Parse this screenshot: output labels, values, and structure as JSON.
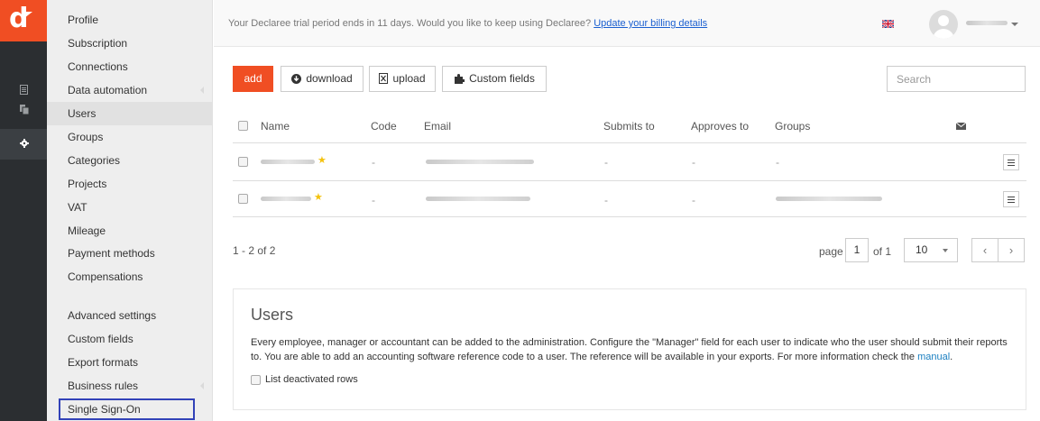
{
  "sidebar": {
    "items": [
      {
        "label": "Profile"
      },
      {
        "label": "Subscription"
      },
      {
        "label": "Connections"
      },
      {
        "label": "Data automation"
      },
      {
        "label": "Users"
      },
      {
        "label": "Groups"
      },
      {
        "label": "Categories"
      },
      {
        "label": "Projects"
      },
      {
        "label": "VAT"
      },
      {
        "label": "Mileage"
      },
      {
        "label": "Payment methods"
      },
      {
        "label": "Compensations"
      }
    ],
    "advanced": [
      {
        "label": "Advanced settings"
      },
      {
        "label": "Custom fields"
      },
      {
        "label": "Export formats"
      },
      {
        "label": "Business rules"
      },
      {
        "label": "Single Sign-On"
      }
    ]
  },
  "topbar": {
    "trial_text": "Your Declaree trial period ends in 11 days. Would you like to keep using Declaree? ",
    "billing_link": "Update your billing details"
  },
  "toolbar": {
    "add_label": "add",
    "download_label": "download",
    "upload_label": "upload",
    "custom_fields_label": "Custom fields",
    "search_placeholder": "Search"
  },
  "table": {
    "columns": {
      "name": "Name",
      "code": "Code",
      "email": "Email",
      "submits_to": "Submits to",
      "approves_to": "Approves to",
      "groups": "Groups"
    },
    "rows": [
      {
        "code": "-",
        "submits_to": "-",
        "approves_to": "-",
        "groups": "-"
      },
      {
        "code": "-",
        "submits_to": "-",
        "approves_to": "-"
      }
    ]
  },
  "pager": {
    "range": "1 - 2 of 2",
    "page_label": "page",
    "page": "1",
    "of_label": "of 1",
    "per_page": "10",
    "prev": "‹",
    "next": "›"
  },
  "info": {
    "title": "Users",
    "description": "Every employee, manager or accountant can be added to the administration. Configure the \"Manager\" field for each user to indicate who the user should submit their reports to. You are able to add an accounting software reference code to a user. The reference will be available in your exports. For more information check the ",
    "manual_link": "manual",
    "description_end": ".",
    "deactivated_label": "List deactivated rows"
  },
  "colors": {
    "brand": "#f04e23",
    "rail": "#2b2e31",
    "sidebar_bg": "#eeeeee",
    "highlight_border": "#3242b8",
    "link": "#1a5fd0"
  },
  "icons": {
    "rail": [
      "document-icon",
      "copy-icon",
      "gear-icon"
    ],
    "toolbar": [
      "download-circle-icon",
      "upload-file-icon",
      "puzzle-icon",
      "envelope-icon"
    ]
  }
}
